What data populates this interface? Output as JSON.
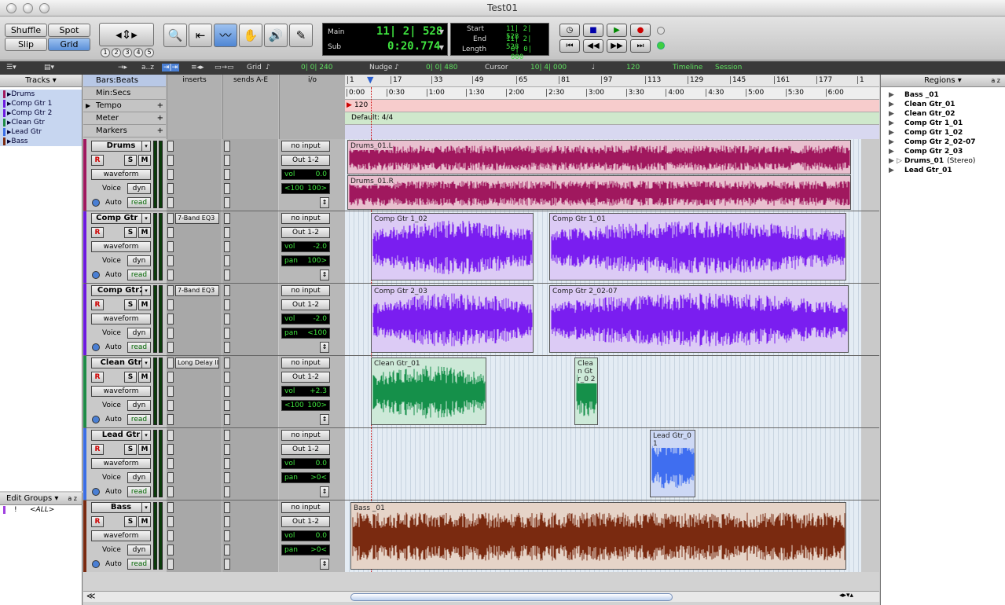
{
  "window": {
    "title": "Test01"
  },
  "edit_modes": {
    "shuffle": "Shuffle",
    "spot": "Spot",
    "slip": "Slip",
    "grid": "Grid"
  },
  "zoom_presets": [
    "1",
    "2",
    "3",
    "4",
    "5"
  ],
  "counters": {
    "main_label": "Main",
    "main_value": "11| 2| 528",
    "sub_label": "Sub",
    "sub_value": "0:20.774",
    "start_label": "Start",
    "start_value": "11| 2| 528",
    "end_label": "End",
    "end_value": "11| 2| 528",
    "length_label": "Length",
    "length_value": "0| 0| 000"
  },
  "subbar": {
    "az": "a..z",
    "grid_label": "Grid",
    "grid_value": "0| 0| 240",
    "nudge_label": "Nudge",
    "nudge_value": "0| 0| 480",
    "cursor_label": "Cursor",
    "cursor_value": "10| 4| 000",
    "tempo_value": "120",
    "timeline_label": "Timeline",
    "session_label": "Session"
  },
  "tracks_panel": {
    "title": "Tracks",
    "items": [
      "Drums",
      "Comp Gtr 1",
      "Comp Gtr 2",
      "Clean Gtr",
      "Lead Gtr",
      "Bass"
    ]
  },
  "groups_panel": {
    "title": "Edit Groups",
    "az": "a z",
    "item_flag": "!",
    "item_label": "<ALL>"
  },
  "columns": {
    "inserts": "inserts",
    "sends": "sends A-E",
    "io": "i/o"
  },
  "rulers": [
    {
      "label": "Bars:Beats",
      "active": true
    },
    {
      "label": "Min:Secs",
      "active": false
    },
    {
      "label": "Tempo",
      "active": false
    },
    {
      "label": "Meter",
      "active": false
    },
    {
      "label": "Markers",
      "active": false
    }
  ],
  "bar_ticks": [
    "1",
    "17",
    "33",
    "49",
    "65",
    "81",
    "97",
    "113",
    "129",
    "145",
    "161",
    "177",
    "1"
  ],
  "time_ticks": [
    "0:00",
    "0:30",
    "1:00",
    "1:30",
    "2:00",
    "2:30",
    "3:00",
    "3:30",
    "4:00",
    "4:30",
    "5:00",
    "5:30",
    "6:00"
  ],
  "tempo_marker": "120",
  "meter_marker": "Default: 4/4",
  "track_strip": {
    "rec": "R",
    "solo": "S",
    "mute": "M",
    "view": "waveform",
    "voice_label": "Voice",
    "voice_value": "dyn",
    "auto_label": "Auto",
    "auto_value": "read",
    "input": "no input",
    "output": "Out 1-2"
  },
  "tracks": [
    {
      "name": "Drums",
      "color": "#a0185e",
      "insert": "",
      "vol_label": "vol",
      "vol": "0.0",
      "pan_label": "<100",
      "pan": "100>",
      "regions": [
        {
          "label": "Drums_01.L",
          "start": 0.005,
          "end": 0.98,
          "lane": "top",
          "bg": "#e9c0cf",
          "wave": "#a0185e"
        },
        {
          "label": "Drums_01.R",
          "start": 0.005,
          "end": 0.98,
          "lane": "bottom",
          "bg": "#e9c0cf",
          "wave": "#a0185e"
        }
      ]
    },
    {
      "name": "Comp Gtr 1",
      "color": "#6d19e0",
      "insert": "7-Band EQ3",
      "vol_label": "vol",
      "vol": "-2.0",
      "pan_label": "pan",
      "pan": "100>",
      "regions": [
        {
          "label": "Comp Gtr 1_02",
          "start": 0.05,
          "end": 0.365,
          "lane": "full",
          "bg": "#dccbf5",
          "wave": "#7a1ef0"
        },
        {
          "label": "Comp Gtr 1_01",
          "start": 0.395,
          "end": 0.97,
          "lane": "full",
          "bg": "#dccbf5",
          "wave": "#7a1ef0"
        }
      ]
    },
    {
      "name": "Comp Gtr2",
      "color": "#6d19e0",
      "insert": "7-Band EQ3",
      "vol_label": "vol",
      "vol": "-2.0",
      "pan_label": "pan",
      "pan": "<100",
      "regions": [
        {
          "label": "Comp Gtr 2_03",
          "start": 0.05,
          "end": 0.365,
          "lane": "full",
          "bg": "#dccbf5",
          "wave": "#7a1ef0"
        },
        {
          "label": "Comp Gtr 2_02-07",
          "start": 0.395,
          "end": 0.975,
          "lane": "full",
          "bg": "#dccbf5",
          "wave": "#7a1ef0"
        }
      ]
    },
    {
      "name": "Clean Gtr",
      "color": "#1e8c46",
      "insert": "Long Delay II",
      "vol_label": "vol",
      "vol": "+2.3",
      "pan_label": "<100",
      "pan": "100>",
      "regions": [
        {
          "label": "Clean Gtr_01",
          "start": 0.05,
          "end": 0.273,
          "lane": "full",
          "bg": "#cde9d8",
          "wave": "#15904a"
        },
        {
          "label": "Clea n Gt r_0 2",
          "start": 0.445,
          "end": 0.49,
          "lane": "full",
          "bg": "#cde9d8",
          "wave": "#15904a"
        }
      ]
    },
    {
      "name": "Lead Gtr",
      "color": "#3a6ee6",
      "insert": "",
      "vol_label": "vol",
      "vol": "0.0",
      "pan_label": "pan",
      "pan": ">0<",
      "regions": [
        {
          "label": "Lead Gtr_0 1",
          "start": 0.59,
          "end": 0.678,
          "lane": "full",
          "bg": "#cdd8f5",
          "wave": "#3f6ef0"
        }
      ]
    },
    {
      "name": "Bass",
      "color": "#7a2a10",
      "insert": "",
      "vol_label": "vol",
      "vol": "0.0",
      "pan_label": "pan",
      "pan": ">0<",
      "regions": [
        {
          "label": "Bass _01",
          "start": 0.01,
          "end": 0.97,
          "lane": "full",
          "bg": "#e6d4c8",
          "wave": "#7a2a10"
        }
      ]
    }
  ],
  "regions_panel": {
    "title": "Regions",
    "az": "a z",
    "items": [
      "Bass _01",
      "Clean Gtr_01",
      "Clean Gtr_02",
      "Comp Gtr 1_01",
      "Comp Gtr 1_02",
      "Comp Gtr 2_02-07",
      "Comp Gtr 2_03",
      "Drums_01",
      "Lead Gtr_01"
    ],
    "stereo_note": "(Stereo)"
  }
}
